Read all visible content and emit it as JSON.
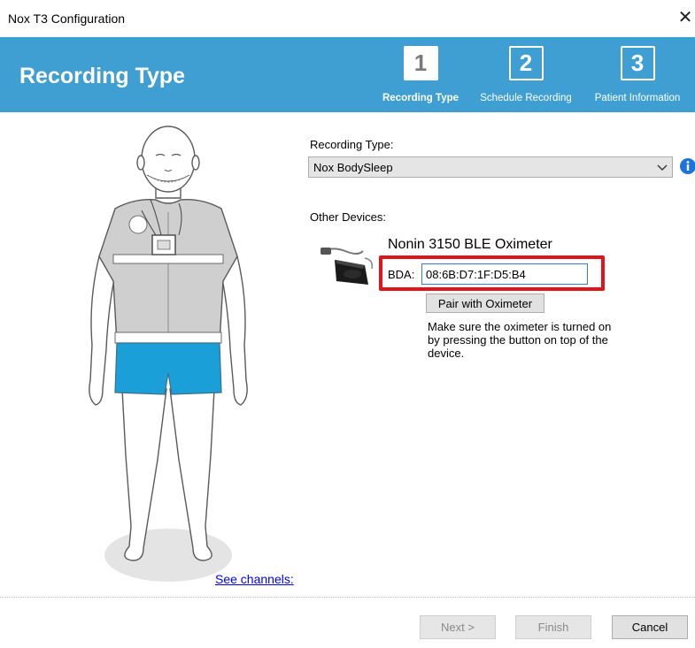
{
  "window": {
    "title": "Nox T3 Configuration",
    "close_glyph": "✕"
  },
  "header": {
    "title": "Recording Type",
    "steps": [
      {
        "number": "1",
        "label": "Recording Type",
        "active": true
      },
      {
        "number": "2",
        "label": "Schedule Recording",
        "active": false
      },
      {
        "number": "3",
        "label": "Patient Information",
        "active": false
      }
    ]
  },
  "figure": {
    "see_channels_label": "See channels:"
  },
  "recording": {
    "label": "Recording Type:",
    "selected": "Nox BodySleep",
    "info_icon": "info-icon"
  },
  "other_devices": {
    "label": "Other Devices:",
    "device_name": "Nonin 3150 BLE Oximeter",
    "bda_label": "BDA:",
    "bda_value": "08:6B:D7:1F:D5:B4",
    "pair_button": "Pair with Oximeter",
    "hint": "Make sure the oximeter is turned on by pressing the button on top of the device."
  },
  "footer": {
    "next": "Next >",
    "finish": "Finish",
    "cancel": "Cancel"
  },
  "colors": {
    "header_bg": "#3f9fd2",
    "highlight": "#e1141c",
    "shorts": "#1b9fd8"
  }
}
